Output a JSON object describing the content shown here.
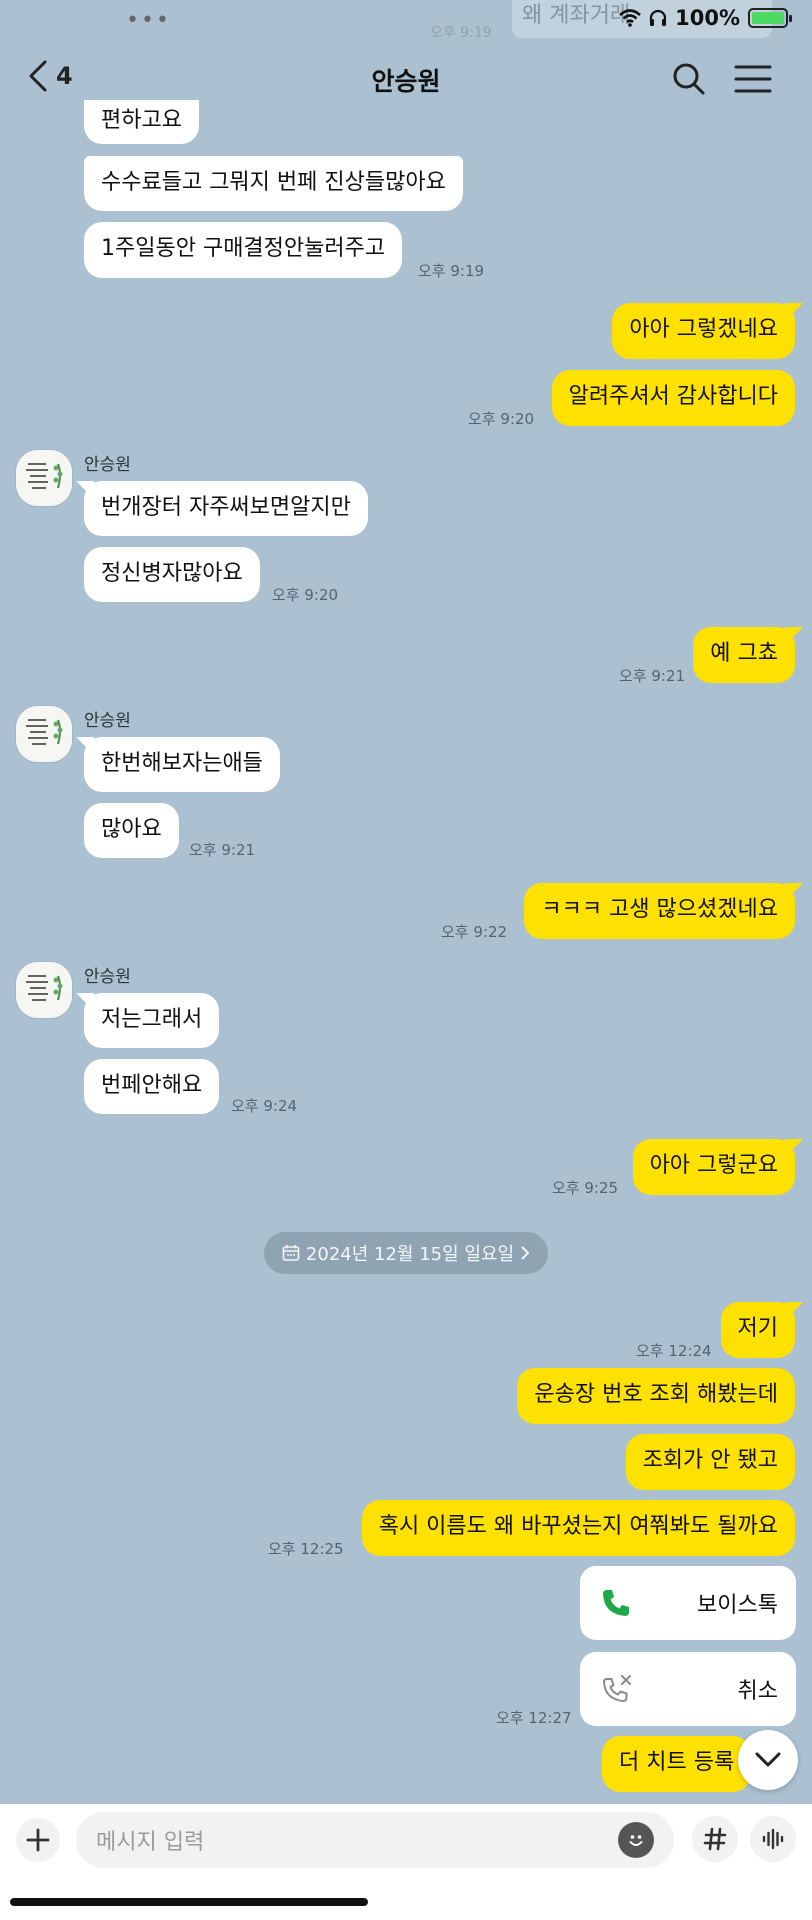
{
  "status_bar": {
    "battery": "100%"
  },
  "ghost_top": {
    "text": "왜 계좌거래",
    "time": "오후 9:19"
  },
  "header": {
    "back_count": "4",
    "title": "안승원"
  },
  "messages": {
    "m1": "편하고요",
    "m2": "수수료들고 그뭐지 번페 진상들많아요",
    "m3": "1주일동안 구매결정안눌러주고",
    "t3": "오후 9:19",
    "o1": "아아 그렇겠네요",
    "o2": "알려주셔서 감사합니다",
    "to2": "오후 9:20",
    "s1": "안승원",
    "m4": "번개장터 자주써보면알지만",
    "m5": "정신병자많아요",
    "t5": "오후 9:20",
    "o3": "예 그쵸",
    "to3": "오후 9:21",
    "s2": "안승원",
    "m6": "한번해보자는애들",
    "m7": "많아요",
    "t7": "오후 9:21",
    "o4": "ㅋㅋㅋ 고생 많으셨겠네요",
    "to4": "오후 9:22",
    "s3": "안승원",
    "m8": "저는그래서",
    "m9": "번페안해요",
    "t9": "오후 9:24",
    "o5": "아아 그렇군요",
    "to5": "오후 9:25",
    "date": "2024년 12월 15일 일요일",
    "o6": "저기",
    "to6": "오후 12:24",
    "o7": "운송장 번호 조회 해봤는데",
    "o8": "조회가 안 됐고",
    "o9": "혹시 이름도 왜 바꾸셨는지 여쭤봐도 될까요",
    "to9": "오후 12:25",
    "call1": "보이스톡",
    "call2": "취소",
    "tcall": "오후 12:27",
    "o10": "더 치트 등록"
  },
  "input": {
    "placeholder": "메시지 입력"
  },
  "colors": {
    "background": "#abc1d1",
    "outgoing": "#ffe100",
    "incoming": "#ffffff",
    "call_green": "#1eaa4a"
  }
}
